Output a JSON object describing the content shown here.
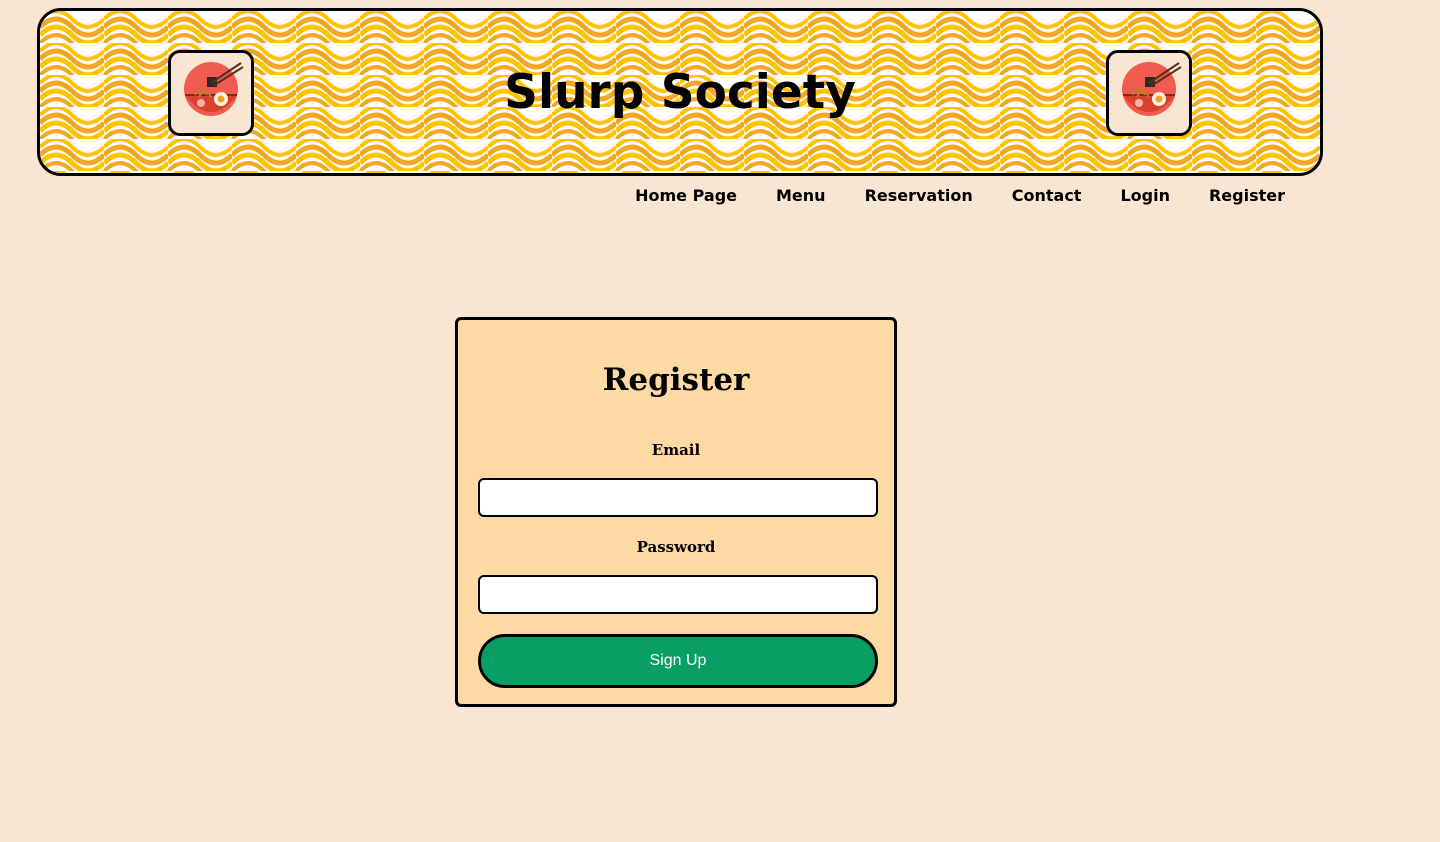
{
  "header": {
    "title": "Slurp Society",
    "logo_icon": "ramen-bowl-icon",
    "pattern_colors": [
      "#f5a623",
      "#ffc400",
      "#ffffff"
    ]
  },
  "nav": {
    "items": [
      {
        "label": "Home Page"
      },
      {
        "label": "Menu"
      },
      {
        "label": "Reservation"
      },
      {
        "label": "Contact"
      },
      {
        "label": "Login"
      },
      {
        "label": "Register"
      }
    ]
  },
  "form": {
    "title": "Register",
    "email_label": "Email",
    "email_value": "",
    "password_label": "Password",
    "password_value": "",
    "submit_label": "Sign Up",
    "submit_color": "#089e64",
    "card_color": "#fdd9a4"
  },
  "page": {
    "background": "#f8e6d2"
  }
}
